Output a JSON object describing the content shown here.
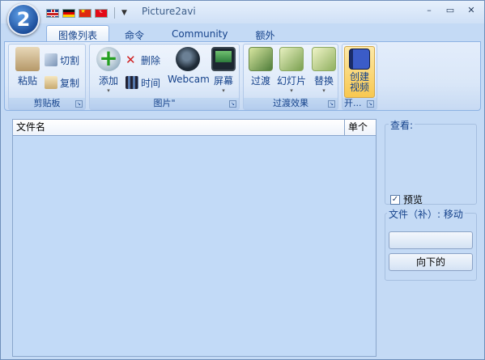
{
  "app": {
    "title": "Picture2avi",
    "orb_glyph": "2"
  },
  "quick_access": {
    "flags": [
      "uk-flag-icon",
      "germany-flag-icon",
      "china-flag-icon",
      "turkey-flag-icon"
    ],
    "dropdown_glyph": "▼"
  },
  "window_controls": {
    "minimize": "–",
    "maximize": "▭",
    "close": "✕"
  },
  "tabs": [
    {
      "label": "图像列表",
      "active": true
    },
    {
      "label": "命令",
      "active": false
    },
    {
      "label": "Community",
      "active": false
    },
    {
      "label": "额外",
      "active": false
    }
  ],
  "ribbon": {
    "clipboard": {
      "label": "剪贴板",
      "paste": "粘贴",
      "cut": "切割",
      "copy": "复制"
    },
    "images": {
      "label": "图片\"",
      "add": "添加",
      "delete": "删除",
      "time": "时间",
      "webcam": "Webcam",
      "screen": "屏幕"
    },
    "transitions": {
      "label": "过渡效果",
      "transition": "过渡",
      "slideshow": "幻灯片",
      "replace": "替换"
    },
    "create": {
      "label": "开...",
      "create_video_line1": "创建",
      "create_video_line2": "视频"
    },
    "dropdown_glyph": "▾",
    "launcher_glyph": "↘"
  },
  "list": {
    "columns": [
      "文件名",
      "单个"
    ]
  },
  "side_panel": {
    "view_title": "查看:",
    "preview_label": "预览",
    "preview_checked": true,
    "file_title": "文件（补）: 移动",
    "up_button": "",
    "down_button": "向下的"
  },
  "colors": {
    "accent": "#15428b",
    "ribbon_border": "#8db2e3",
    "background": "#c4daf5"
  }
}
